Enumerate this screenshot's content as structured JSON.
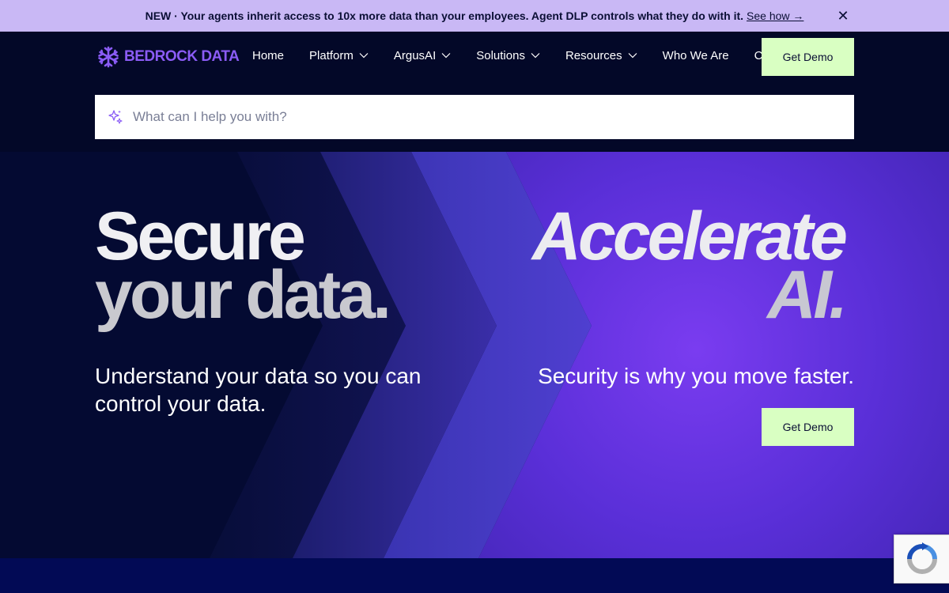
{
  "announcement": {
    "text": "NEW · Your agents inherit access to 10x more data than your employees. Agent DLP controls what they do with it.",
    "link": "See how →",
    "close_icon": "close-icon"
  },
  "nav": {
    "logo_text": "BEDROCK DATA",
    "items": [
      {
        "label": "Home",
        "dropdown": false
      },
      {
        "label": "Platform",
        "dropdown": true
      },
      {
        "label": "ArgusAI",
        "dropdown": true
      },
      {
        "label": "Solutions",
        "dropdown": true
      },
      {
        "label": "Resources",
        "dropdown": true
      },
      {
        "label": "Who We Are",
        "dropdown": false
      },
      {
        "label": "Careers",
        "dropdown": false
      }
    ],
    "cta": "Get Demo"
  },
  "search": {
    "placeholder": "What can I help you with?",
    "icon": "sparkle-icon"
  },
  "hero": {
    "left_line1": "Secure",
    "left_line2": "your data.",
    "right_line1": "Accelerate",
    "right_line2": "AI.",
    "left_sub": "Understand your data so you can control your data.",
    "right_sub": "Security is why you move faster.",
    "cta": "Get Demo"
  },
  "colors": {
    "announce_bg": "#c9b8f5",
    "nav_bg": "#030828",
    "cta_bg": "#d9ffc2",
    "accent": "#8b5cf6"
  }
}
